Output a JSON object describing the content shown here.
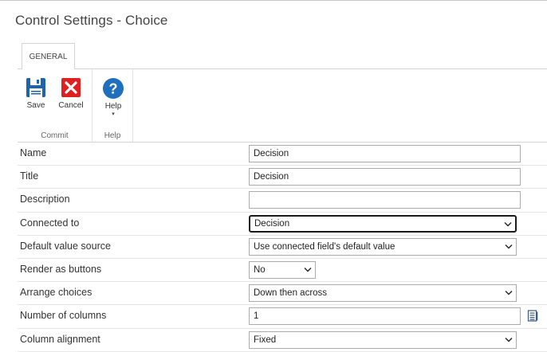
{
  "dialog": {
    "title": "Control Settings - Choice"
  },
  "ribbon": {
    "tab": "GENERAL",
    "commit_group": {
      "label": "Commit",
      "save": "Save",
      "cancel": "Cancel"
    },
    "help_group": {
      "label": "Help",
      "help": "Help"
    }
  },
  "fields": {
    "name": {
      "label": "Name",
      "value": "Decision"
    },
    "title": {
      "label": "Title",
      "value": "Decision"
    },
    "description": {
      "label": "Description",
      "value": ""
    },
    "connected_to": {
      "label": "Connected to",
      "value": "Decision"
    },
    "default_value_source": {
      "label": "Default value source",
      "value": "Use connected field's default value"
    },
    "render_as_buttons": {
      "label": "Render as buttons",
      "value": "No"
    },
    "arrange_choices": {
      "label": "Arrange choices",
      "value": "Down then across"
    },
    "number_of_columns": {
      "label": "Number of columns",
      "value": "1"
    },
    "column_alignment": {
      "label": "Column alignment",
      "value": "Fixed"
    }
  },
  "icons": {
    "save": "floppy-disk-icon",
    "cancel": "red-x-icon",
    "help": "question-mark-circle-icon",
    "picker": "list-picker-icon",
    "chevron": "chevron-down-icon"
  },
  "colors": {
    "save_blue": "#1e63b0",
    "cancel_red": "#e02020",
    "help_blue": "#1f6fbf"
  }
}
